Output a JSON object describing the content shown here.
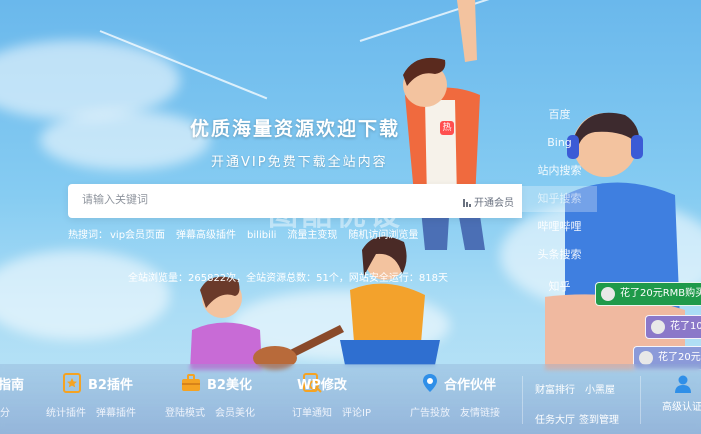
{
  "hero": {
    "title": "优质海量资源欢迎下载",
    "badge": "热",
    "subtitle": "开通VIP免费下载全站内容"
  },
  "search": {
    "placeholder": "请输入关键词",
    "vip_link": "开通会员",
    "watermark": "图酷优设"
  },
  "hot_search": {
    "label": "热搜词：",
    "terms": [
      "vip会员页面",
      "弹幕高级插件",
      "bilibili",
      "流量主变现",
      "随机访问浏览量"
    ]
  },
  "stats": {
    "text": "全站浏览量：265822次，全站资源总数：51个，网站安全运行：818天"
  },
  "engines": [
    "百度",
    "Bing",
    "站内搜索",
    "知乎搜索",
    "哔哩哔哩",
    "头条搜索",
    "知乎"
  ],
  "toasts": [
    "花了20元RMB购买了",
    "花了10",
    "花了20元"
  ],
  "bottom_nav": {
    "g0": {
      "title": "指南",
      "links": [
        "分"
      ]
    },
    "g1": {
      "title": "B2插件",
      "links": [
        "统计插件",
        "弹幕插件"
      ]
    },
    "g2": {
      "title": "B2美化",
      "links": [
        "登陆模式",
        "会员美化"
      ]
    },
    "g3": {
      "title": "WP修改",
      "links": [
        "订单通知",
        "评论IP"
      ]
    },
    "g4": {
      "title": "合作伙伴",
      "links": [
        "广告投放",
        "友情链接"
      ]
    },
    "right": {
      "row1": [
        "财富排行",
        "小黑屋"
      ],
      "row2": [
        "任务大厅",
        "签到管理"
      ]
    },
    "user": "高级认证"
  },
  "colors": {
    "sky": "#7cc3ee",
    "hot_badge": "#ff4f4f",
    "toast_green": "#1f9a4a",
    "toast_purple": "#8b78c9"
  }
}
